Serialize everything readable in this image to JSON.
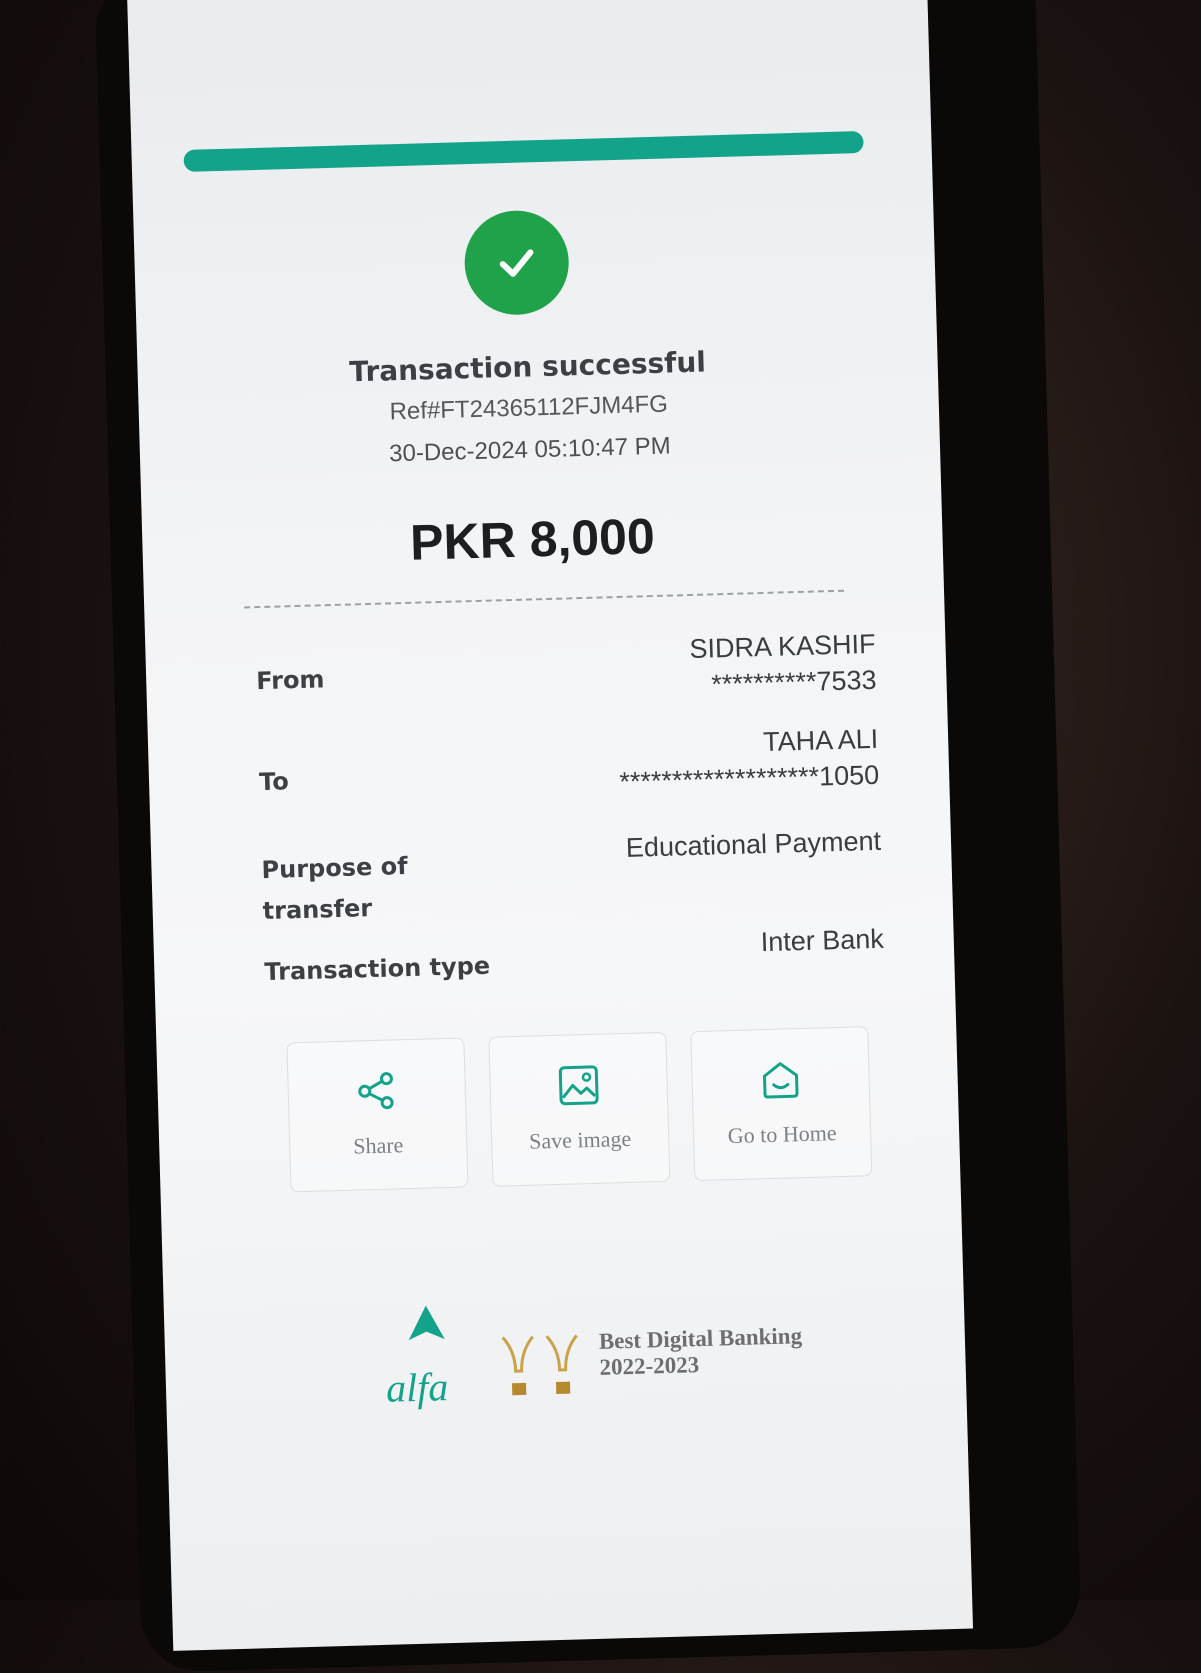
{
  "receipt": {
    "status_title": "Transaction successful",
    "reference": "Ref#FT24365112FJM4FG",
    "datetime": "30-Dec-2024 05:10:47 PM",
    "amount": "PKR 8,000",
    "rows": {
      "from": {
        "label": "From",
        "name": "SIDRA KASHIF",
        "account": "**********7533"
      },
      "to": {
        "label": "To",
        "name": "TAHA ALI",
        "account": "*******************1050"
      },
      "purpose": {
        "label_line1": "Purpose of",
        "label_line2": "transfer",
        "value": "Educational Payment"
      },
      "type": {
        "label": "Transaction type",
        "value": "Inter Bank"
      }
    }
  },
  "actions": {
    "share": {
      "label": "Share",
      "icon": "share-icon"
    },
    "save": {
      "label": "Save image",
      "icon": "image-icon"
    },
    "home": {
      "label": "Go to Home",
      "icon": "home-icon"
    }
  },
  "footer": {
    "brand": "alfa",
    "award_line1": "Best Digital Banking",
    "award_line2": "2022-2023"
  },
  "colors": {
    "accent": "#13a38a",
    "success": "#1fa24a"
  }
}
